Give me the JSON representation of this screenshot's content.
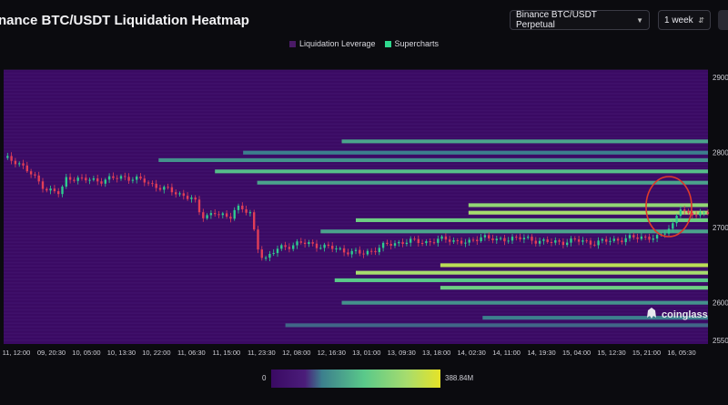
{
  "header": {
    "title": "nance BTC/USDT Liquidation Heatmap",
    "pair_select": "Binance BTC/USDT Perpetual",
    "range_select": "1 week"
  },
  "legend": [
    {
      "label": "Liquidation Leverage",
      "color": "#4a1a66"
    },
    {
      "label": "Supercharts",
      "color": "#2fd88e"
    }
  ],
  "watermark": "coinglass",
  "colorbar": {
    "min_label": "0",
    "max_label": "388.84M"
  },
  "colors": {
    "background": "#3a0a63",
    "candle_up": "#2ecc8f",
    "candle_down": "#e23e57",
    "highlight": "#e03a2a"
  },
  "chart_data": {
    "type": "heatmap",
    "x_tick_labels": [
      "11, 12:00",
      "09, 20:30",
      "10, 05:00",
      "10, 13:30",
      "10, 22:00",
      "11, 06:30",
      "11, 15:00",
      "11, 23:30",
      "12, 08:00",
      "12, 16:30",
      "13, 01:00",
      "13, 09:30",
      "13, 18:00",
      "14, 02:30",
      "14, 11:00",
      "14, 19:30",
      "15, 04:00",
      "15, 12:30",
      "15, 21:00",
      "16, 05:30"
    ],
    "y_tick_labels": [
      "2900",
      "2800",
      "2700",
      "2600",
      "2550"
    ],
    "y_ticks": [
      29000,
      28000,
      27000,
      26000,
      25500
    ],
    "ylim": [
      25450,
      29100
    ],
    "colorbar_max": 388.84,
    "colorbar_unit": "M",
    "bands": [
      {
        "price": 28150,
        "start": 0.48,
        "intensity": 0.55
      },
      {
        "price": 28000,
        "start": 0.34,
        "intensity": 0.45
      },
      {
        "price": 27900,
        "start": 0.22,
        "intensity": 0.5
      },
      {
        "price": 27750,
        "start": 0.3,
        "intensity": 0.62
      },
      {
        "price": 27600,
        "start": 0.36,
        "intensity": 0.55
      },
      {
        "price": 27300,
        "start": 0.66,
        "intensity": 0.8
      },
      {
        "price": 27200,
        "start": 0.66,
        "intensity": 0.85
      },
      {
        "price": 27100,
        "start": 0.5,
        "intensity": 0.7
      },
      {
        "price": 26950,
        "start": 0.45,
        "intensity": 0.55
      },
      {
        "price": 26500,
        "start": 0.62,
        "intensity": 0.9
      },
      {
        "price": 26400,
        "start": 0.5,
        "intensity": 0.85
      },
      {
        "price": 26300,
        "start": 0.47,
        "intensity": 0.65
      },
      {
        "price": 26200,
        "start": 0.62,
        "intensity": 0.7
      },
      {
        "price": 26000,
        "start": 0.48,
        "intensity": 0.5
      },
      {
        "price": 25800,
        "start": 0.68,
        "intensity": 0.45
      },
      {
        "price": 25700,
        "start": 0.4,
        "intensity": 0.4
      }
    ],
    "price_series": [
      {
        "t": 0.0,
        "p": 27930
      },
      {
        "t": 0.02,
        "p": 27880
      },
      {
        "t": 0.04,
        "p": 27700
      },
      {
        "t": 0.06,
        "p": 27520
      },
      {
        "t": 0.08,
        "p": 27450
      },
      {
        "t": 0.09,
        "p": 27680
      },
      {
        "t": 0.11,
        "p": 27640
      },
      {
        "t": 0.14,
        "p": 27630
      },
      {
        "t": 0.17,
        "p": 27680
      },
      {
        "t": 0.2,
        "p": 27620
      },
      {
        "t": 0.22,
        "p": 27540
      },
      {
        "t": 0.25,
        "p": 27450
      },
      {
        "t": 0.27,
        "p": 27380
      },
      {
        "t": 0.28,
        "p": 27150
      },
      {
        "t": 0.3,
        "p": 27200
      },
      {
        "t": 0.32,
        "p": 27110
      },
      {
        "t": 0.33,
        "p": 27300
      },
      {
        "t": 0.35,
        "p": 27180
      },
      {
        "t": 0.36,
        "p": 26750
      },
      {
        "t": 0.37,
        "p": 26580
      },
      {
        "t": 0.39,
        "p": 26720
      },
      {
        "t": 0.42,
        "p": 26800
      },
      {
        "t": 0.45,
        "p": 26760
      },
      {
        "t": 0.48,
        "p": 26700
      },
      {
        "t": 0.51,
        "p": 26650
      },
      {
        "t": 0.54,
        "p": 26760
      },
      {
        "t": 0.57,
        "p": 26820
      },
      {
        "t": 0.6,
        "p": 26810
      },
      {
        "t": 0.63,
        "p": 26850
      },
      {
        "t": 0.66,
        "p": 26790
      },
      {
        "t": 0.68,
        "p": 26900
      },
      {
        "t": 0.7,
        "p": 26820
      },
      {
        "t": 0.72,
        "p": 26870
      },
      {
        "t": 0.75,
        "p": 26840
      },
      {
        "t": 0.78,
        "p": 26800
      },
      {
        "t": 0.81,
        "p": 26830
      },
      {
        "t": 0.84,
        "p": 26800
      },
      {
        "t": 0.87,
        "p": 26840
      },
      {
        "t": 0.89,
        "p": 26860
      },
      {
        "t": 0.91,
        "p": 26880
      },
      {
        "t": 0.93,
        "p": 26860
      },
      {
        "t": 0.95,
        "p": 27050
      },
      {
        "t": 0.96,
        "p": 27280
      },
      {
        "t": 0.97,
        "p": 27150
      },
      {
        "t": 0.98,
        "p": 27190
      },
      {
        "t": 1.0,
        "p": 27210
      }
    ]
  }
}
